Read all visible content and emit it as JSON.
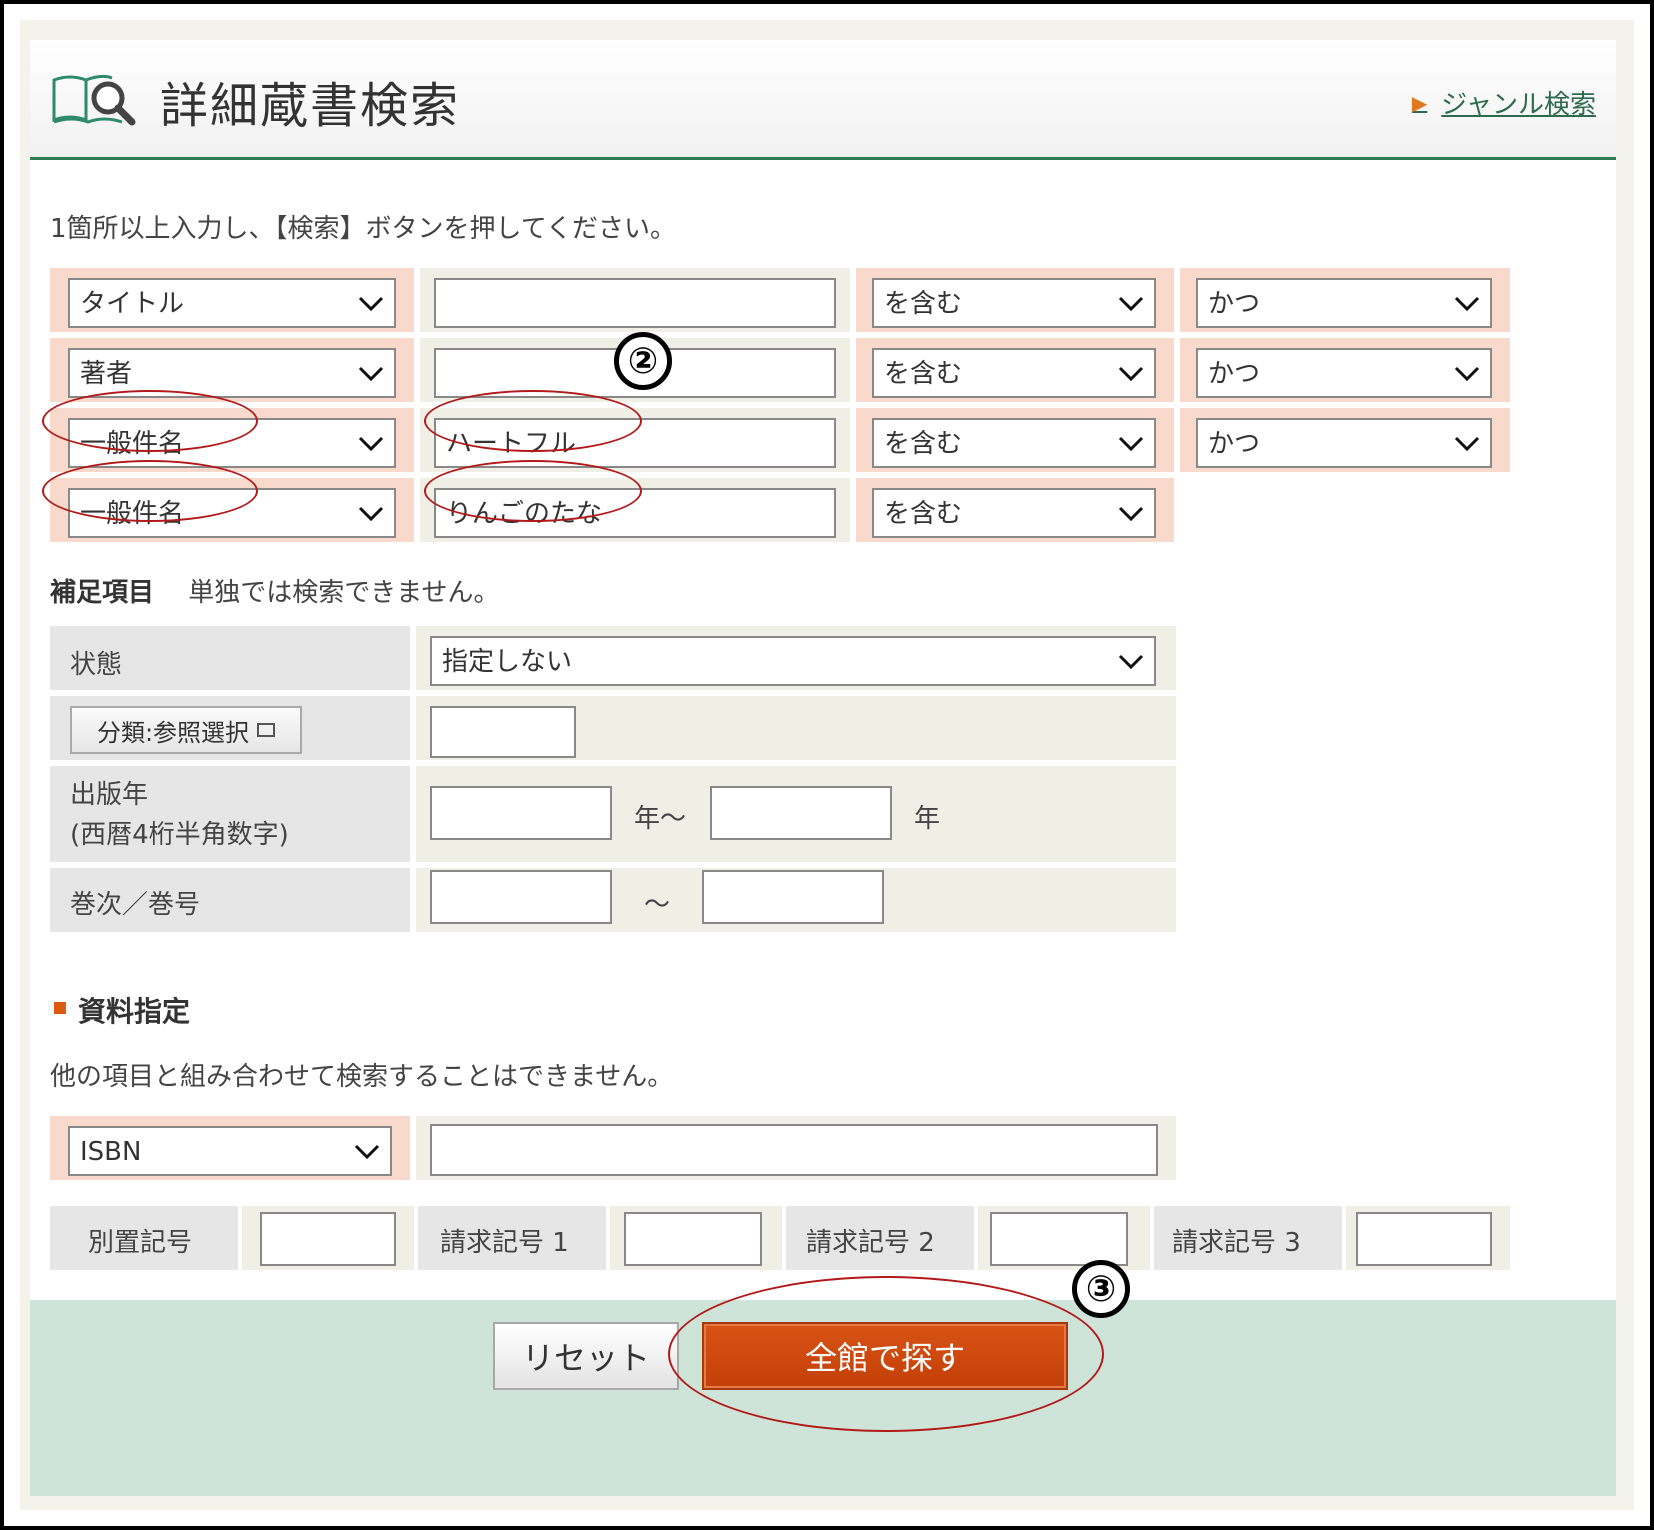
{
  "header": {
    "title": "詳細蔵書検索",
    "genre_link": "ジャンル検索"
  },
  "instruction": "1箇所以上入力し、【検索】ボタンを押してください。",
  "search_rows": [
    {
      "field": "タイトル",
      "value": "",
      "match": "を含む",
      "logic": "かつ"
    },
    {
      "field": "著者",
      "value": "",
      "match": "を含む",
      "logic": "かつ"
    },
    {
      "field": "一般件名",
      "value": "ハートフル",
      "match": "を含む",
      "logic": "かつ"
    },
    {
      "field": "一般件名",
      "value": "りんごのたな",
      "match": "を含む"
    }
  ],
  "supplement": {
    "heading": "補足項目",
    "note": "単独では検索できません。",
    "status_label": "状態",
    "status_value": "指定しない",
    "classification_button": "分類:参照選択",
    "pub_year_label_1": "出版年",
    "pub_year_label_2": "(西暦4桁半角数字)",
    "year_suffix_1": "年～",
    "year_suffix_2": "年",
    "volume_label": "巻次／巻号",
    "range_sep": "～"
  },
  "material": {
    "heading": "資料指定",
    "note": "他の項目と組み合わせて検索することはできません。",
    "isbn_select": "ISBN",
    "code_labels": [
      "別置記号",
      "請求記号 1",
      "請求記号 2",
      "請求記号 3"
    ]
  },
  "buttons": {
    "reset": "リセット",
    "search_all": "全館で探す"
  },
  "annotations": {
    "marker_2": "②",
    "marker_3": "③"
  },
  "colors": {
    "accent_green": "#2e7d52",
    "search_button": "#c94a0c",
    "highlight_pink": "#f9d9cb",
    "annotation_red": "#b21a1a",
    "footer_green": "#cfe4d8"
  }
}
